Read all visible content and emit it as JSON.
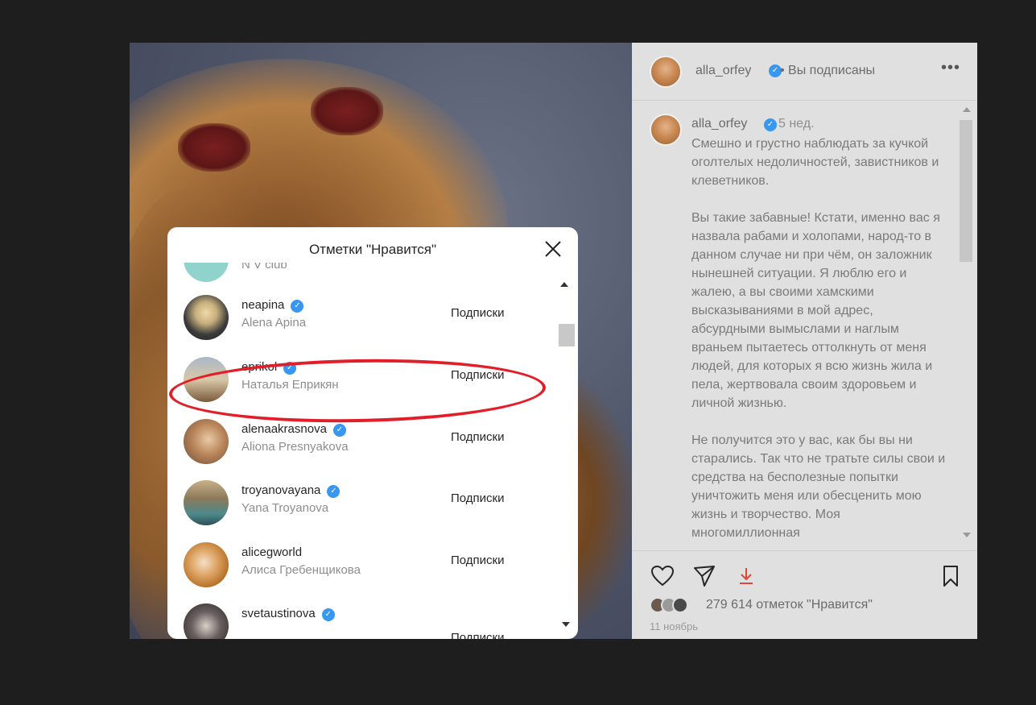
{
  "photo": {
    "description_icon": "photo-icon"
  },
  "likes_modal": {
    "title": "Отметки \"Нравится\"",
    "close_icon": "close-icon",
    "partial_top_row": {
      "full_name": "N V club"
    },
    "items": [
      {
        "username": "neapina",
        "full_name": "Alena Apina",
        "verified": true,
        "button": "Подписки"
      },
      {
        "username": "eprikol",
        "full_name": "Наталья Еприкян",
        "verified": true,
        "button": "Подписки"
      },
      {
        "username": "alenaakrasnova",
        "full_name": "Aliona Presnyakova",
        "verified": true,
        "button": "Подписки"
      },
      {
        "username": "troyanovayana",
        "full_name": "Yana Troyanova",
        "verified": true,
        "button": "Подписки"
      },
      {
        "username": "alicegworld",
        "full_name": "Алиса Гребенщикова",
        "verified": false,
        "button": "Подписки"
      },
      {
        "username": "svetaustinova",
        "full_name": "",
        "verified": true,
        "button": "Подписки"
      }
    ]
  },
  "post": {
    "username": "alla_orfey",
    "follow_status": "• Вы подписаны",
    "time_ago": "5 нед.",
    "caption": "Смешно и грустно наблюдать за кучкой оголтелых недоличностей, завистников и клеветников.\n\nВы такие забавные! Кстати, именно вас я назвала рабами и холопами, народ-то в данном случае ни при чём, он заложник нынешней ситуации. Я люблю его и жалею, а вы своими хамскими высказываниями в мой адрес, абсурдными вымыслами и наглым враньем пытаетесь оттолкнуть от меня людей, для которых я всю жизнь жила и пела, жертвовала своим здоровьем и личной жизнью.\n\nНе получится это у вас, как бы вы ни старались. Так что не тратьте силы свои и средства на бесполезные попытки уничтожить меня или обесценить мою жизнь и творчество. Моя многомиллионная",
    "likes": "279 614 отметок \"Нравится\"",
    "date": "11 ноябрь"
  },
  "colors": {
    "highlight": "#e21e28",
    "verified": "#3897f0",
    "download": "#e0453a"
  }
}
